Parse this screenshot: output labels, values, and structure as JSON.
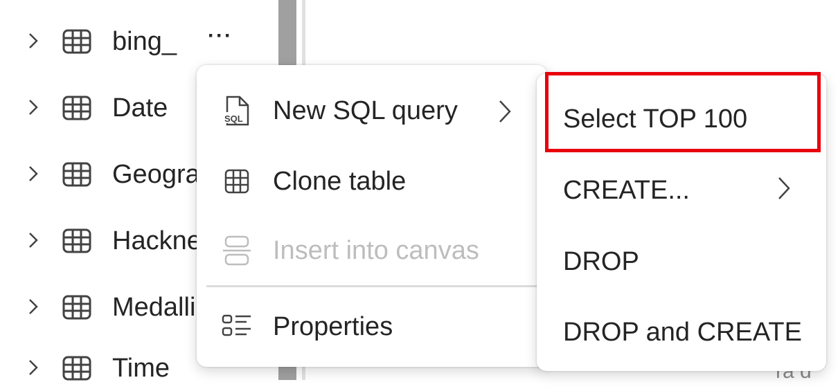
{
  "explorer": {
    "tables": [
      {
        "label": "bing_",
        "has_more": true
      },
      {
        "label": "Date"
      },
      {
        "label": "Geography"
      },
      {
        "label": "HackneyLicense"
      },
      {
        "label": "Medallion"
      },
      {
        "label": "Time"
      }
    ],
    "more_button_label": "···",
    "partial_text": "ra d"
  },
  "context_menu": {
    "items": [
      {
        "label": "New SQL query",
        "icon": "sql-file-icon",
        "has_submenu": true,
        "disabled": false
      },
      {
        "label": "Clone table",
        "icon": "table-icon",
        "has_submenu": false,
        "disabled": false
      },
      {
        "label": "Insert into canvas",
        "icon": "insert-canvas-icon",
        "has_submenu": false,
        "disabled": true
      },
      {
        "label": "Properties",
        "icon": "properties-icon",
        "has_submenu": false,
        "disabled": false
      }
    ]
  },
  "submenu": {
    "items": [
      {
        "label": "Select TOP 100",
        "highlighted": true
      },
      {
        "label": "CREATE...",
        "has_submenu": true
      },
      {
        "label": "DROP"
      },
      {
        "label": "DROP and CREATE"
      }
    ]
  },
  "colors": {
    "highlight_border": "#e8000b",
    "disabled_text": "#bdbdbd",
    "text": "#242424",
    "scrollbar": "#a0a0a0"
  }
}
